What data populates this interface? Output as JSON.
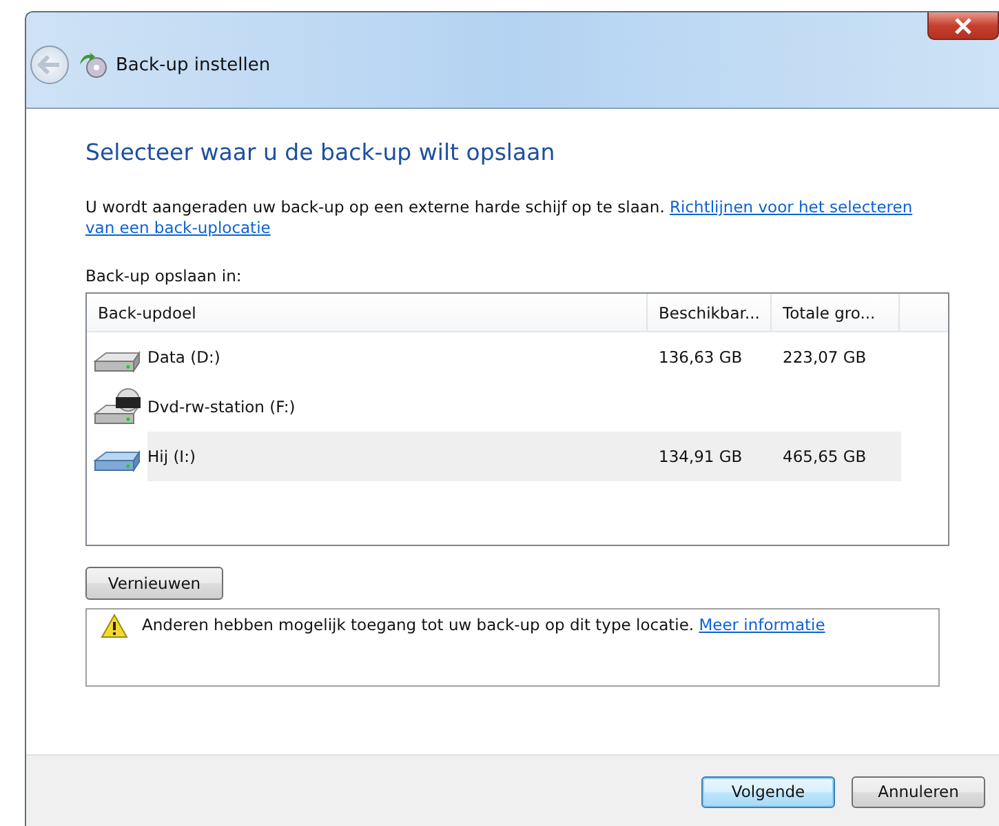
{
  "window": {
    "title": "Back-up instellen"
  },
  "heading": "Selecteer waar u de back-up wilt opslaan",
  "intro": {
    "text": "U wordt aangeraden uw back-up op een externe harde schijf op te slaan.",
    "link_lines": [
      "Richtlijnen voor het selecteren",
      "van een back-uplocatie"
    ]
  },
  "list_label": "Back-up opslaan in:",
  "table": {
    "columns": [
      "Back-updoel",
      "Beschikbar...",
      "Totale gro..."
    ],
    "rows": [
      {
        "kind": "hdd",
        "name": "Data (D:)",
        "available": "136,63 GB",
        "total": "223,07 GB",
        "selected": false
      },
      {
        "kind": "dvd",
        "name": "Dvd-rw-station (F:)",
        "selected": false
      },
      {
        "kind": "external",
        "name": "Hij (I:)",
        "available": "134,91 GB",
        "total": "465,65 GB",
        "selected": true
      }
    ]
  },
  "refresh_button": "Vernieuwen",
  "notice": {
    "text": "Anderen hebben mogelijk toegang tot uw back-up op dit type locatie.",
    "link": "Meer informatie"
  },
  "buttons": [
    {
      "label": "Volgende",
      "default": true
    },
    {
      "label": "Annuleren",
      "default": false
    }
  ]
}
